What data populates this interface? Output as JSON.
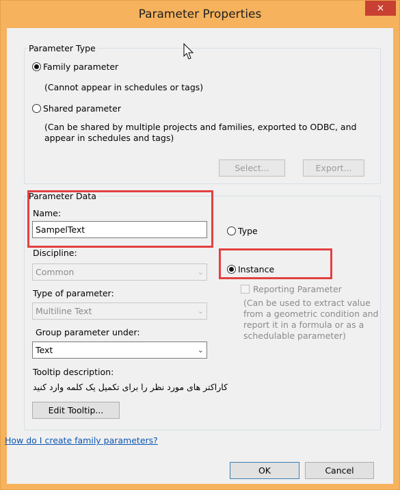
{
  "dialog": {
    "title": "Parameter Properties",
    "close_glyph": "×"
  },
  "parameter_type": {
    "legend": "Parameter Type",
    "family_label": "Family parameter",
    "family_desc": "(Cannot appear in schedules or tags)",
    "shared_label": "Shared parameter",
    "shared_desc": "(Can be shared by multiple projects and families, exported to ODBC, and appear in schedules and tags)",
    "select_label": "Select...",
    "export_label": "Export...",
    "selected": "family"
  },
  "parameter_data": {
    "legend": "Parameter Data",
    "name_label": "Name:",
    "name_value": "SampelText",
    "discipline_label": "Discipline:",
    "discipline_value": "Common",
    "type_label": "Type of parameter:",
    "type_value": "Multiline Text",
    "group_label": "Group parameter under:",
    "group_value": "Text",
    "type_radio_label": "Type",
    "instance_radio_label": "Instance",
    "instance_selected": true,
    "reporting_label": "Reporting Parameter",
    "reporting_desc": "(Can be used to extract value from a geometric condition and report it in a formula or as a schedulable parameter)",
    "tooltip_label": "Tooltip description:",
    "tooltip_value": "کاراکتر های مورد نظر را برای تکمیل یک کلمه وارد کنید",
    "edit_tooltip_label": "Edit Tooltip..."
  },
  "footer": {
    "help_link": "How do I create family parameters?",
    "ok_label": "OK",
    "cancel_label": "Cancel"
  },
  "colors": {
    "title_bar": "#f6b25c",
    "close": "#c84031",
    "highlight": "#e2403f",
    "link": "#0b55b3"
  }
}
